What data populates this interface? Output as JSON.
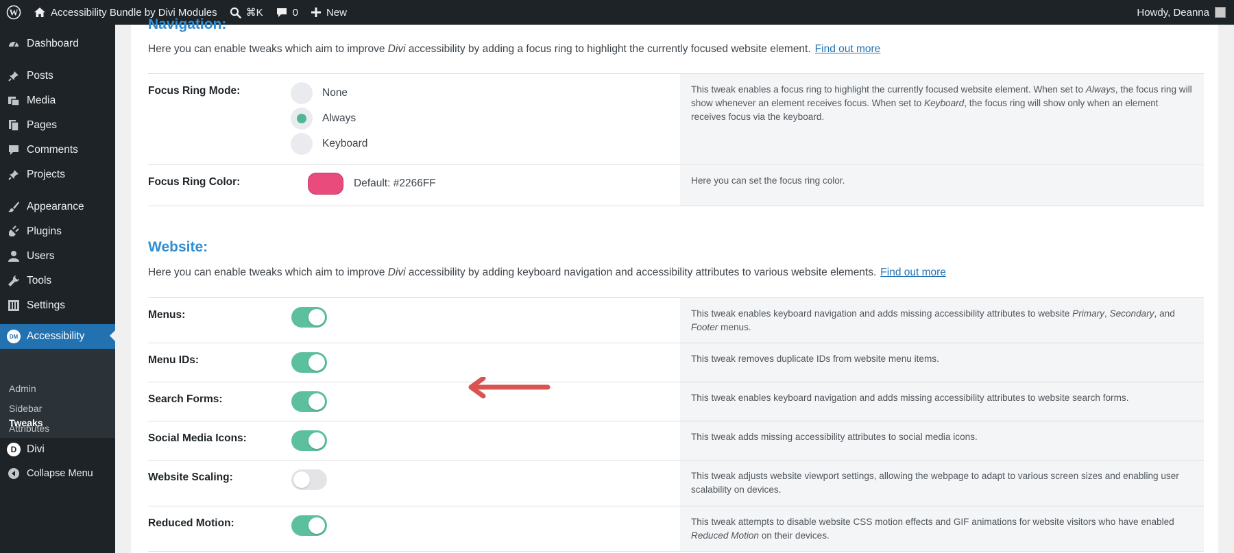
{
  "adminbar": {
    "site_name": "Accessibility Bundle by Divi Modules",
    "search_shortcut": "⌘K",
    "comments_count": "0",
    "new_label": "New",
    "howdy": "Howdy, Deanna"
  },
  "sidebar": {
    "items": [
      {
        "label": "Dashboard",
        "icon": "dashboard-icon"
      },
      {
        "label": "Posts",
        "icon": "pin-icon"
      },
      {
        "label": "Media",
        "icon": "media-icon"
      },
      {
        "label": "Pages",
        "icon": "pages-icon"
      },
      {
        "label": "Comments",
        "icon": "comment-icon"
      },
      {
        "label": "Projects",
        "icon": "pin-icon"
      },
      {
        "label": "Appearance",
        "icon": "brush-icon"
      },
      {
        "label": "Plugins",
        "icon": "plug-icon"
      },
      {
        "label": "Users",
        "icon": "user-icon"
      },
      {
        "label": "Tools",
        "icon": "wrench-icon"
      },
      {
        "label": "Settings",
        "icon": "settings-icon"
      },
      {
        "label": "Accessibility",
        "icon": "dm-badge-icon",
        "badge": "DM"
      },
      {
        "label": "Divi",
        "icon": "divi-icon",
        "badge": "D"
      },
      {
        "label": "Collapse Menu",
        "icon": "collapse-icon"
      }
    ],
    "submenu": [
      "Admin",
      "Sidebar",
      "Attributes",
      "Tweaks"
    ]
  },
  "navigation": {
    "title": "Navigation:",
    "desc_before": "Here you can enable tweaks which aim to improve ",
    "desc_em": "Divi",
    "desc_after": " accessibility by adding a focus ring to highlight the currently focused website element.",
    "link": "Find out more",
    "focus_ring_mode": {
      "label": "Focus Ring Mode:",
      "options": [
        "None",
        "Always",
        "Keyboard"
      ],
      "selected": "Always",
      "help": [
        "This tweak enables a focus ring to highlight the currently focused website element. When set to ",
        "Always",
        ", the focus ring will show whenever an element receives focus. When set to ",
        "Keyboard",
        ", the focus ring will show only when an element receives focus via the keyboard."
      ]
    },
    "focus_ring_color": {
      "label": "Focus Ring Color:",
      "swatch_color": "#e94b7c",
      "default_text": "Default: #2266FF",
      "help": "Here you can set the focus ring color."
    }
  },
  "website": {
    "title": "Website:",
    "desc_before": "Here you can enable tweaks which aim to improve ",
    "desc_em": "Divi",
    "desc_after": " accessibility by adding keyboard navigation and accessibility attributes to various website elements.",
    "link": "Find out more",
    "rows": [
      {
        "label": "Menus:",
        "on": true,
        "help": [
          "This tweak enables keyboard navigation and adds missing accessibility attributes to website ",
          "Primary",
          ", ",
          "Secondary",
          ", and ",
          "Footer",
          " menus."
        ]
      },
      {
        "label": "Menu IDs:",
        "on": true,
        "help": [
          "This tweak removes duplicate IDs from website menu items."
        ]
      },
      {
        "label": "Search Forms:",
        "on": true,
        "help": [
          "This tweak enables keyboard navigation and adds missing accessibility attributes to website search forms."
        ]
      },
      {
        "label": "Social Media Icons:",
        "on": true,
        "help": [
          "This tweak adds missing accessibility attributes to social media icons."
        ]
      },
      {
        "label": "Website Scaling:",
        "on": false,
        "help": [
          "This tweak adjusts website viewport settings, allowing the webpage to adapt to various screen sizes and enabling user scalability on devices."
        ]
      },
      {
        "label": "Reduced Motion:",
        "on": true,
        "help": [
          "This tweak attempts to disable website CSS motion effects and GIF animations for website visitors who have enabled ",
          "Reduced Motion",
          " on their devices."
        ]
      }
    ]
  },
  "colors": {
    "toggle_on": "#5cbf9d",
    "toggle_off": "#e2e4e7",
    "accent_title": "#2e8dd3",
    "arrow": "#d9534f"
  }
}
